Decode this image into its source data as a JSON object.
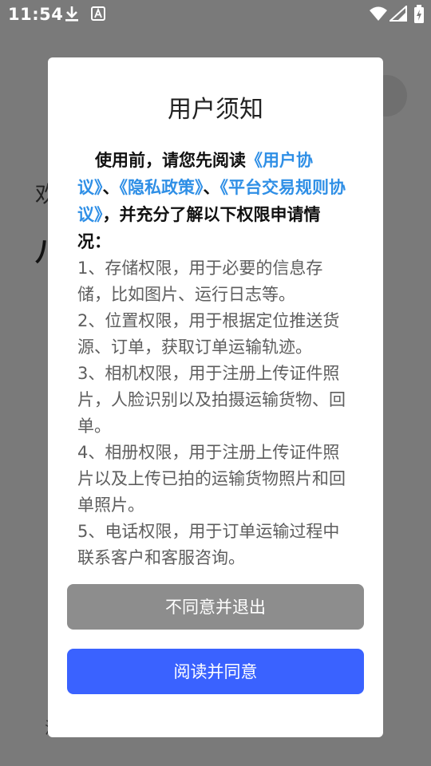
{
  "status_bar": {
    "time": "11:54"
  },
  "background": {
    "line1": "欢",
    "line2": "八",
    "line3": "注"
  },
  "dialog": {
    "title": "用户须知",
    "intro_prefix": "使用前，请您先阅读",
    "link_user_agreement": "《用户协议》",
    "sep1": "、",
    "link_privacy_policy": "《隐私政策》",
    "sep2": "、",
    "link_platform_rules": "《平台交易规则协议》",
    "intro_suffix": "，并充分了解以下权限申请情况：",
    "permissions": [
      "1、存储权限，用于必要的信息存储，比如图片、运行日志等。",
      "2、位置权限，用于根据定位推送货源、订单，获取订单运输轨迹。",
      "3、相机权限，用于注册上传证件照片，人脸识别以及拍摄运输货物、回单。",
      "4、相册权限，用于注册上传证件照片以及上传已拍的运输货物照片和回单照片。",
      "5、电话权限，用于订单运输过程中联系客户和客服咨询。"
    ],
    "decline_label": "不同意并退出",
    "agree_label": "阅读并同意"
  },
  "colors": {
    "link": "#2f8fe6",
    "agree_button": "#3a62ff",
    "decline_button": "#8d8d8d",
    "overlay": "#7a7a7a"
  }
}
